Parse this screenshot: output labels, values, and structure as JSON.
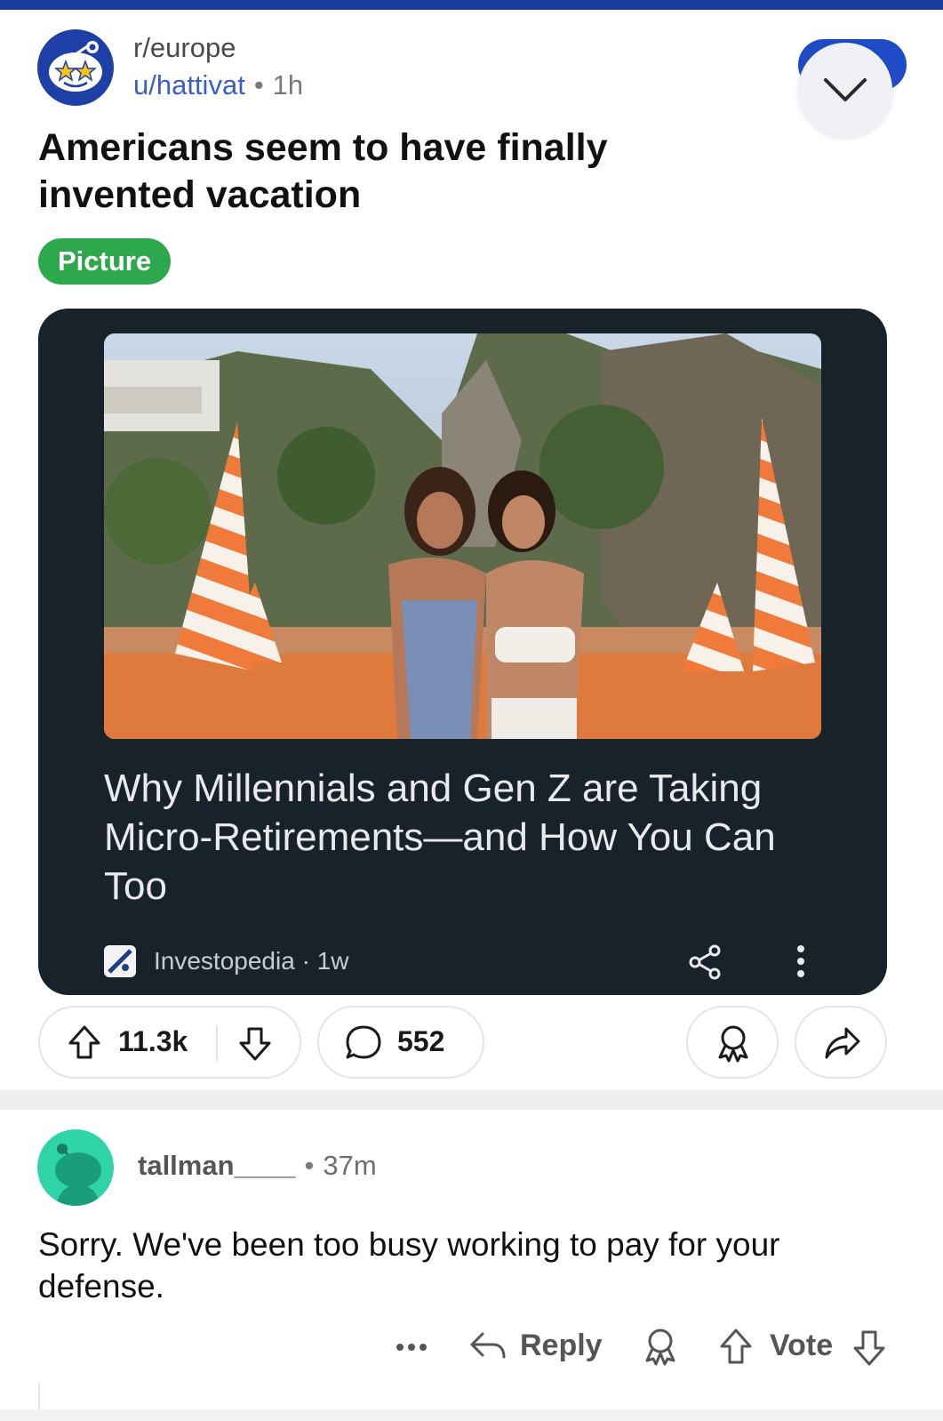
{
  "post": {
    "subreddit": "r/europe",
    "author": "u/hattivat",
    "separator": "•",
    "time": "1h",
    "title": "Americans seem to have finally invented vacation",
    "flair": "Picture",
    "flair_color": "#2ea84c"
  },
  "link_card": {
    "headline": "Why Millennials and Gen Z are Taking Micro-Retirements—and How You Can Too",
    "source": "Investopedia · 1w",
    "background": "#18222a"
  },
  "actions": {
    "upvotes": "11.3k",
    "comments": "552"
  },
  "comment": {
    "username": "tallman____",
    "separator": "•",
    "time": "37m",
    "body": "Sorry. We've been too busy working to pay for your defense.",
    "reply_label": "Reply",
    "vote_label": "Vote"
  },
  "icons": {
    "more": "chevron-down-icon",
    "upvote": "arrow-up-icon",
    "downvote": "arrow-down-icon",
    "comment": "speech-bubble-icon",
    "award": "award-ribbon-icon",
    "share": "share-arrow-icon"
  },
  "colors": {
    "brand_blue": "#1a3a9e",
    "link_blue": "#3a5fc4",
    "comment_avatar": "#2fd3a8"
  }
}
